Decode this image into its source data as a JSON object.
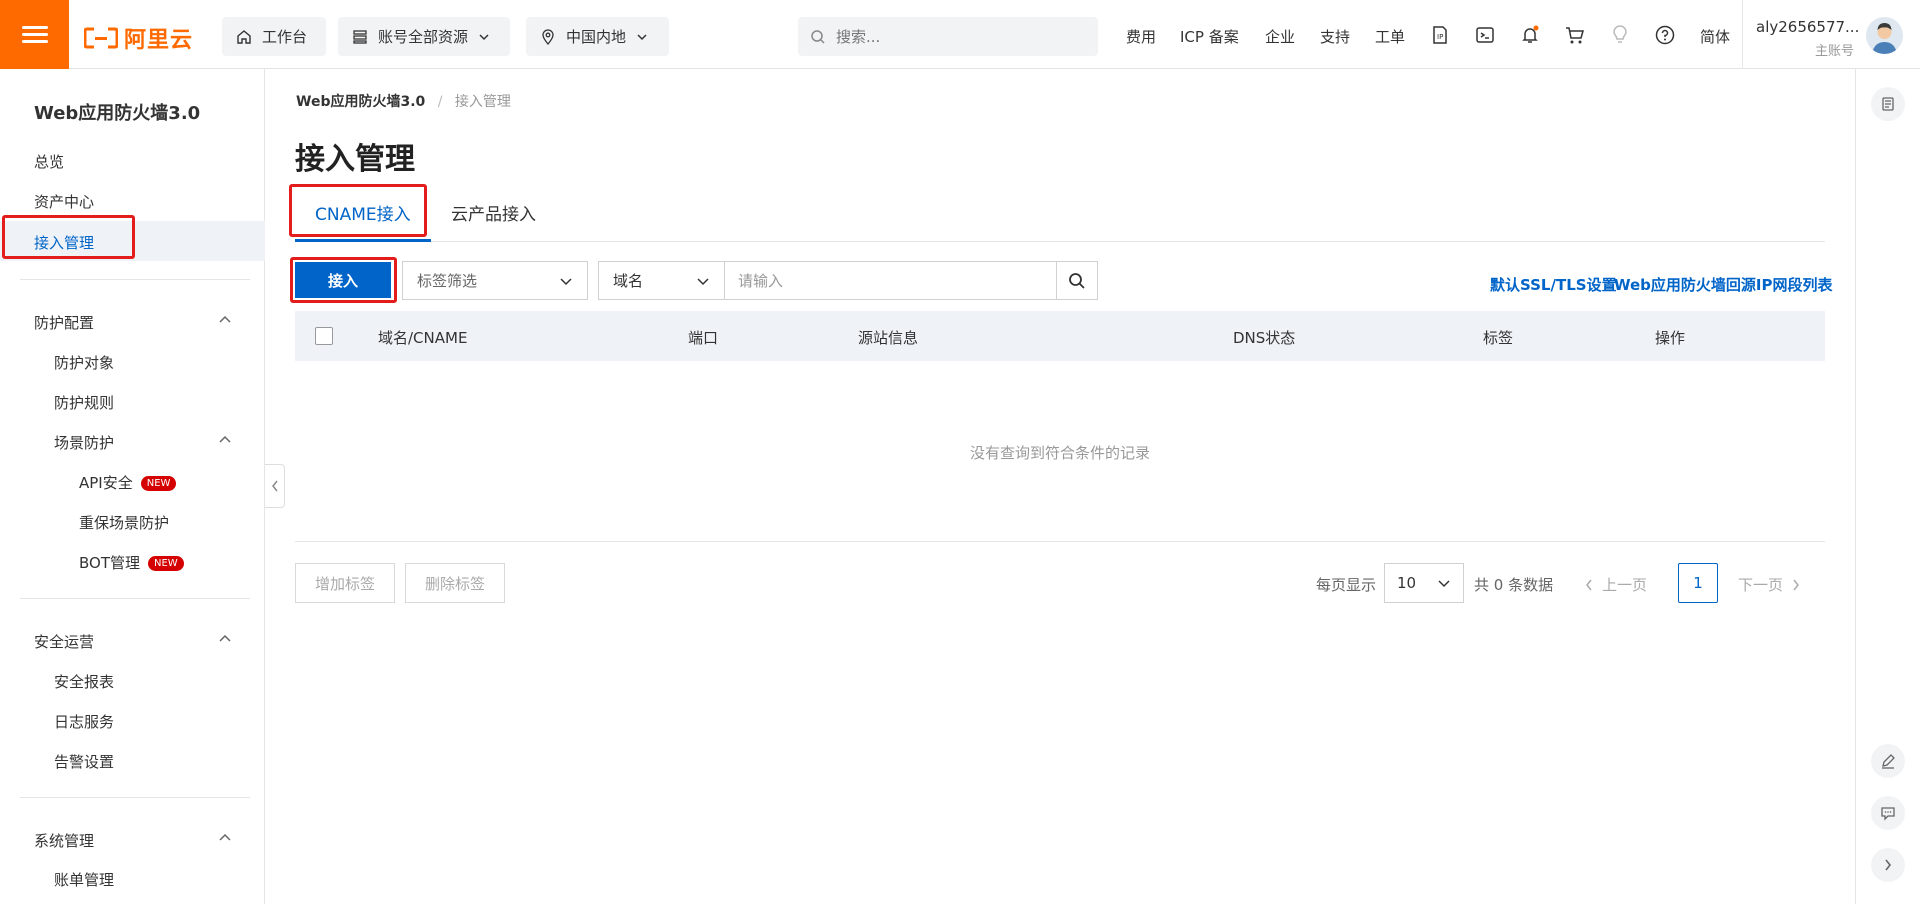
{
  "topbar": {
    "logo_text": "阿里云",
    "workbench": "工作台",
    "resources": "账号全部资源",
    "region": "中国内地",
    "search_placeholder": "搜索...",
    "links": [
      "费用",
      "ICP 备案",
      "企业",
      "支持",
      "工单"
    ],
    "language": "简体",
    "account_name": "aly2656577...",
    "account_type": "主账号",
    "accent_color": "#ff6a00"
  },
  "sidebar": {
    "title": "Web应用防火墙3.0",
    "top_items": [
      "总览",
      "资产中心",
      "接入管理"
    ],
    "active_item": "接入管理",
    "groups": {
      "protection": {
        "label": "防护配置",
        "items": [
          "防护对象",
          "防护规则"
        ],
        "scene": {
          "label": "场景防护",
          "items": [
            "API安全",
            "重保场景防护",
            "BOT管理"
          ],
          "badge": "NEW"
        }
      },
      "ops": {
        "label": "安全运营",
        "items": [
          "安全报表",
          "日志服务",
          "告警设置"
        ]
      },
      "system": {
        "label": "系统管理",
        "items": [
          "账单管理"
        ]
      }
    }
  },
  "breadcrumb": {
    "root": "Web应用防火墙3.0",
    "separator": "/",
    "current": "接入管理"
  },
  "page": {
    "title": "接入管理",
    "tabs": [
      "CNAME接入",
      "云产品接入"
    ],
    "active_tab": "CNAME接入"
  },
  "toolbar": {
    "add_button": "接入",
    "tag_filter": "标签筛选",
    "field_select": "域名",
    "keyword_placeholder": "请输入",
    "link_ssl": "默认SSL/TLS设置",
    "link_ip": "Web应用防火墙回源IP网段列表"
  },
  "table": {
    "columns": [
      "域名/CNAME",
      "端口",
      "源站信息",
      "DNS状态",
      "标签",
      "操作"
    ],
    "empty_text": "没有查询到符合条件的记录"
  },
  "footer": {
    "add_tag": "增加标签",
    "remove_tag": "删除标签",
    "per_page_label": "每页显示",
    "page_size": "10",
    "total": "共 0 条数据",
    "prev": "上一页",
    "current_page": "1",
    "next": "下一页"
  },
  "colors": {
    "primary": "#0064c8",
    "highlight_box": "#e31c1c",
    "badge_new": "#d50000"
  }
}
